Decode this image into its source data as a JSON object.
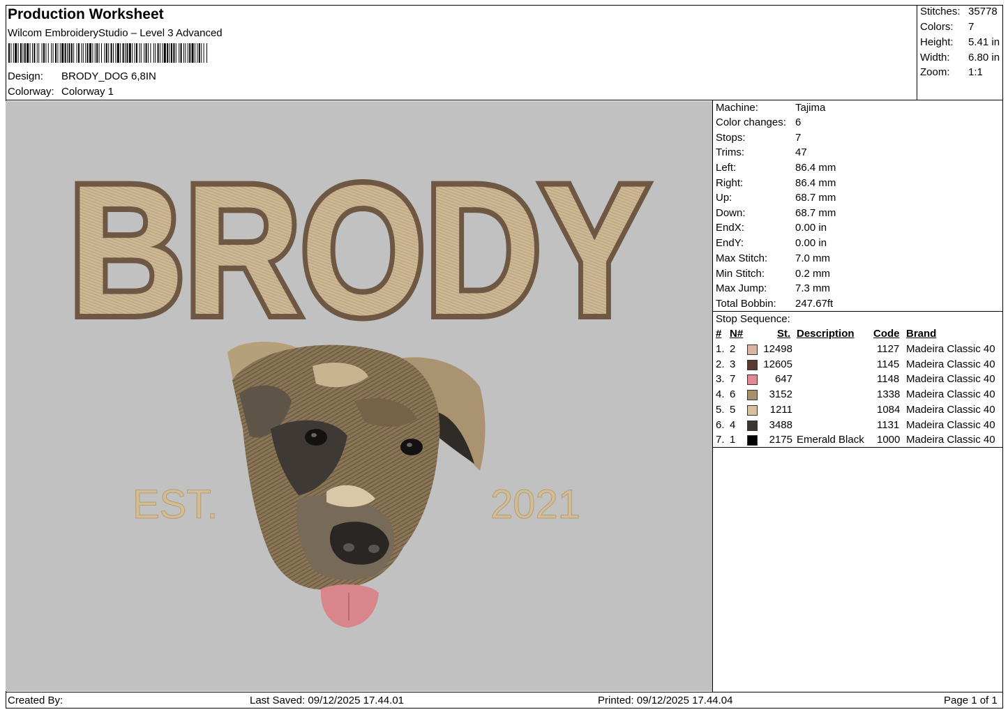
{
  "header": {
    "title": "Production Worksheet",
    "software": "Wilcom EmbroideryStudio – Level 3 Advanced",
    "design_label": "Design:",
    "design_value": "BRODY_DOG 6,8IN",
    "colorway_label": "Colorway:",
    "colorway_value": "Colorway 1"
  },
  "summary": [
    {
      "label": "Stitches:",
      "value": "35778"
    },
    {
      "label": "Colors:",
      "value": "7"
    },
    {
      "label": "Height:",
      "value": "5.41 in"
    },
    {
      "label": "Width:",
      "value": "6.80 in"
    },
    {
      "label": "Zoom:",
      "value": "1:1"
    }
  ],
  "machine_info": [
    {
      "label": "Machine:",
      "value": "Tajima"
    },
    {
      "label": "Color changes:",
      "value": "6"
    },
    {
      "label": "Stops:",
      "value": "7"
    },
    {
      "label": "Trims:",
      "value": "47"
    },
    {
      "label": "Left:",
      "value": "86.4 mm"
    },
    {
      "label": "Right:",
      "value": "86.4 mm"
    },
    {
      "label": "Up:",
      "value": "68.7 mm"
    },
    {
      "label": "Down:",
      "value": "68.7 mm"
    },
    {
      "label": "EndX:",
      "value": "0.00 in"
    },
    {
      "label": "EndY:",
      "value": "0.00 in"
    },
    {
      "label": "Max Stitch:",
      "value": "7.0 mm"
    },
    {
      "label": "Min Stitch:",
      "value": "0.2 mm"
    },
    {
      "label": "Max Jump:",
      "value": "7.3 mm"
    },
    {
      "label": "Total Bobbin:",
      "value": "247.67ft"
    }
  ],
  "stop_sequence": {
    "title": "Stop Sequence:",
    "headers": {
      "num": "#",
      "n": "N#",
      "st": "St.",
      "desc": "Description",
      "code": "Code",
      "brand": "Brand"
    },
    "rows": [
      {
        "num": "1.",
        "n": "2",
        "color": "#d9b4a0",
        "st": "12498",
        "desc": "",
        "code": "1127",
        "brand": "Madeira Classic 40"
      },
      {
        "num": "2.",
        "n": "3",
        "color": "#5a3a2e",
        "st": "12605",
        "desc": "",
        "code": "1145",
        "brand": "Madeira Classic 40"
      },
      {
        "num": "3.",
        "n": "7",
        "color": "#e08a96",
        "st": "647",
        "desc": "",
        "code": "1148",
        "brand": "Madeira Classic 40"
      },
      {
        "num": "4.",
        "n": "6",
        "color": "#a8906a",
        "st": "3152",
        "desc": "",
        "code": "1338",
        "brand": "Madeira Classic 40"
      },
      {
        "num": "5.",
        "n": "5",
        "color": "#d8c09c",
        "st": "1211",
        "desc": "",
        "code": "1084",
        "brand": "Madeira Classic 40"
      },
      {
        "num": "6.",
        "n": "4",
        "color": "#3a3632",
        "st": "3488",
        "desc": "",
        "code": "1131",
        "brand": "Madeira Classic 40"
      },
      {
        "num": "7.",
        "n": "1",
        "color": "#000000",
        "st": "2175",
        "desc": "Emerald Black",
        "code": "1000",
        "brand": "Madeira Classic 40"
      }
    ]
  },
  "design_text": {
    "name": "BRODY",
    "est": "EST.",
    "year": "2021"
  },
  "colors": {
    "canvas": "#c1c1c1",
    "letter_fill": "#cdb896",
    "letter_outline": "#6e5844",
    "est_text": "#d2bd94"
  },
  "footer": {
    "created_by": "Created By:",
    "last_saved": "Last Saved: 09/12/2025 17.44.01",
    "printed": "Printed: 09/12/2025 17.44.04",
    "page": "Page 1 of 1"
  }
}
